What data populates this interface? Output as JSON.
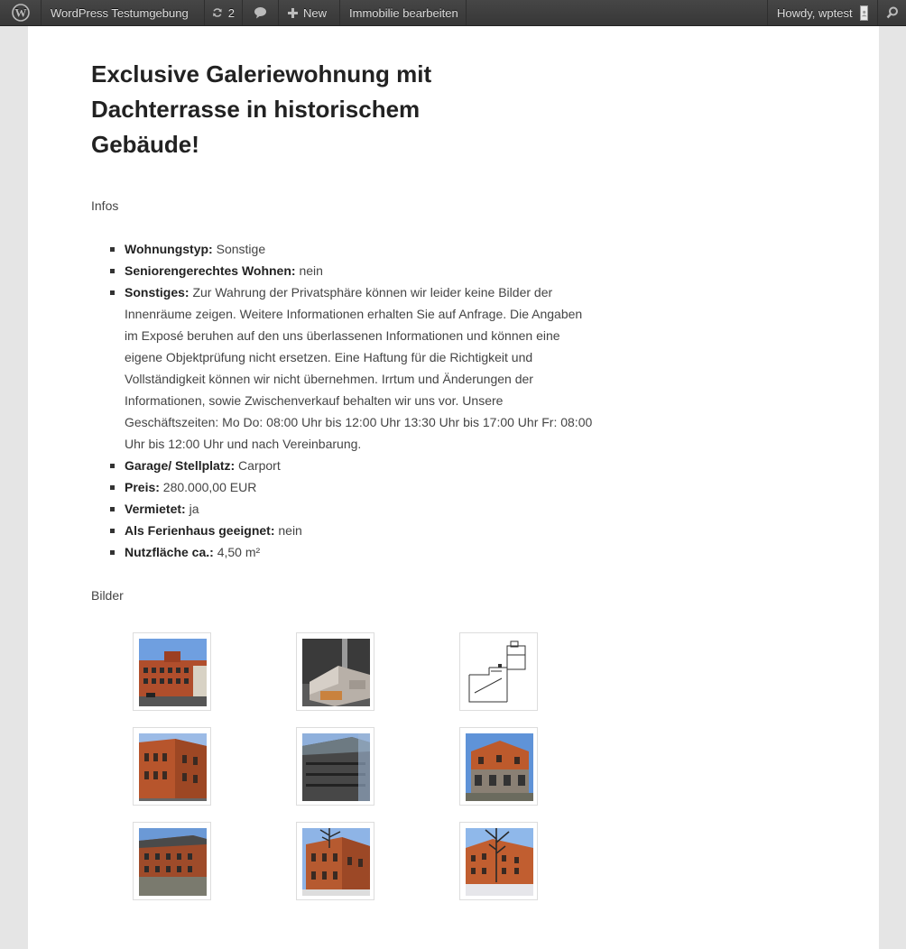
{
  "adminbar": {
    "wp_logo_icon": "wordpress-logo-icon",
    "site_name": "WordPress Testumgebung",
    "updates_count": "2",
    "new_label": "New",
    "edit_label": "Immobilie bearbeiten",
    "howdy": "Howdy, wptest"
  },
  "article": {
    "title": "Exclusive Galeriewohnung mit Dachterrasse in historischem Gebäude!",
    "infos_label": "Infos",
    "details": [
      {
        "key": "Wohnungstyp:",
        "value": " Sonstige"
      },
      {
        "key": "Seniorengerechtes Wohnen:",
        "value": " nein"
      },
      {
        "key": "Sonstiges:",
        "value": " Zur Wahrung der Privatsphäre können wir leider keine Bilder der Innenräume zeigen. Weitere Informationen erhalten Sie auf Anfrage. Die Angaben im Exposé beruhen auf den uns überlassenen Informationen und können eine eigene Objektprüfung nicht ersetzen. Eine Haftung für die Richtigkeit und Vollständigkeit können wir nicht übernehmen. Irrtum und Änderungen der Informationen, sowie Zwischenverkauf behalten wir uns vor. Unsere Geschäftszeiten: Mo  Do: 08:00 Uhr bis 12:00 Uhr 13:30 Uhr bis 17:00 Uhr Fr: 08:00 Uhr bis 12:00 Uhr und nach Vereinbarung."
      },
      {
        "key": "Garage/ Stellplatz:",
        "value": " Carport"
      },
      {
        "key": "Preis:",
        "value": " 280.000,00 EUR"
      },
      {
        "key": "Vermietet:",
        "value": " ja"
      },
      {
        "key": "Als Ferienhaus geeignet:",
        "value": " nein"
      },
      {
        "key": "Nutzfläche ca.:",
        "value": " 4,50 m²"
      }
    ],
    "bilder_label": "Bilder"
  },
  "colors": {
    "adminbar_bg": "#464646",
    "page_bg": "#ffffff",
    "outer_bg": "#e5e5e5",
    "brick": "#b5562f",
    "sky": "#5a8fd0"
  }
}
